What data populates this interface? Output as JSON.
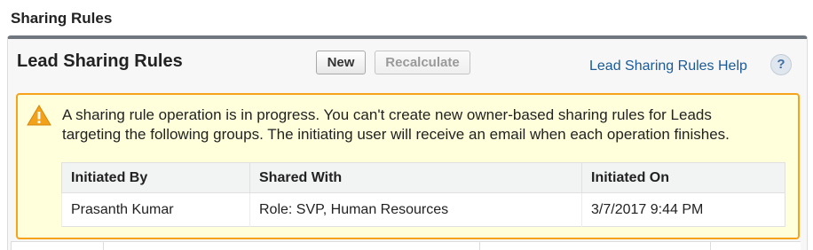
{
  "page": {
    "section_title": "Sharing Rules"
  },
  "panel": {
    "title": "Lead Sharing Rules",
    "buttons": {
      "new_label": "New",
      "recalculate_label": "Recalculate"
    },
    "help_link": "Lead Sharing Rules Help",
    "help_icon_glyph": "?"
  },
  "warning": {
    "icon": "warning-triangle-icon",
    "message": "A sharing rule operation is in progress. You can't create new owner-based sharing rules for Leads targeting the following groups. The initiating user will receive an email when each operation finishes.",
    "table": {
      "headers": [
        "Initiated By",
        "Shared With",
        "Initiated On"
      ],
      "rows": [
        [
          "Prasanth Kumar",
          "Role: SVP, Human Resources",
          "3/7/2017 9:44 PM"
        ]
      ]
    }
  },
  "colors": {
    "warning_border": "#f7a31a",
    "warning_bg": "#ffffdc",
    "link": "#1a5a96",
    "panel_top_border": "#70777e"
  }
}
